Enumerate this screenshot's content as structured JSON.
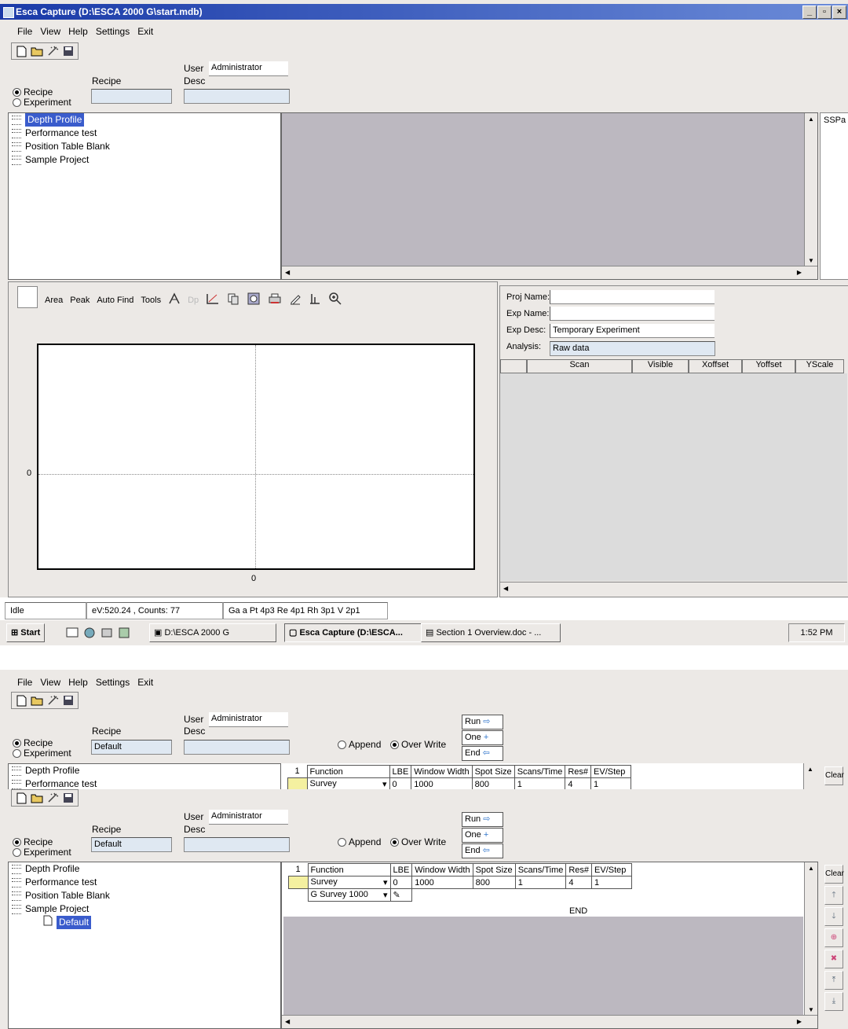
{
  "top": {
    "title": "Esca Capture (D:\\ESCA 2000 G\\start.mdb)",
    "menu": [
      "File",
      "View",
      "Help",
      "Settings",
      "Exit"
    ],
    "user_label": "User",
    "user_value": "Administrator",
    "desc_label": "Desc",
    "recipe_label": "Recipe",
    "radio_recipe": "Recipe",
    "radio_experiment": "Experiment",
    "tree": [
      {
        "label": "Depth Profile",
        "selected": true
      },
      {
        "label": "Performance test",
        "selected": false
      },
      {
        "label": "Position Table Blank",
        "selected": false
      },
      {
        "label": "Sample Project",
        "selected": false
      }
    ],
    "side_label": "SSPa",
    "plot_toolbar": [
      "Area",
      "Peak",
      "Auto Find",
      "Tools"
    ],
    "plot_y_zero": "0",
    "plot_x_zero": "0",
    "proj_name_label": "Proj Name:",
    "exp_name_label": "Exp Name:",
    "exp_desc_label": "Exp Desc:",
    "exp_desc_value": "Temporary Experiment",
    "analysis_label": "Analysis:",
    "analysis_value": "Raw data",
    "scan_columns": [
      "Scan",
      "Visible",
      "Xoffset",
      "Yoffset",
      "YScale"
    ],
    "status": {
      "state": "Idle",
      "readout": "eV:520.24 , Counts: 77",
      "elements": "Ga a  Pt 4p3  Re 4p1  Rh 3p1  V 2p1"
    },
    "taskbar": {
      "start": "Start",
      "items": [
        "D:\\ESCA 2000 G",
        "Esca Capture (D:\\ESCA...",
        "Section 1 Overview.doc - ..."
      ],
      "clock": "1:52 PM"
    }
  },
  "middle": {
    "menu": [
      "File",
      "View",
      "Help",
      "Settings",
      "Exit"
    ],
    "user_label": "User",
    "user_value": "Administrator",
    "desc_label": "Desc",
    "recipe_label": "Recipe",
    "recipe_value": "Default",
    "radio_recipe": "Recipe",
    "radio_experiment": "Experiment",
    "append": "Append",
    "overwrite": "Over Write",
    "run": "Run",
    "one": "One",
    "end": "End",
    "tree": [
      "Depth Profile",
      "Performance test"
    ],
    "grid_headers": [
      "1",
      "Function",
      "LBE",
      "Window Width",
      "Spot Size",
      "Scans/Time",
      "Res#",
      "EV/Step"
    ],
    "grid_row": [
      "",
      "Survey",
      "0",
      "1000",
      "800",
      "1",
      "4",
      "1"
    ],
    "clear": "Clear"
  },
  "bottom": {
    "user_label": "User",
    "user_value": "Administrator",
    "desc_label": "Desc",
    "recipe_label": "Recipe",
    "recipe_value": "Default",
    "radio_recipe": "Recipe",
    "radio_experiment": "Experiment",
    "append": "Append",
    "overwrite": "Over Write",
    "run": "Run",
    "one": "One",
    "end": "End",
    "tree": [
      "Depth Profile",
      "Performance test",
      "Position Table Blank",
      "Sample Project"
    ],
    "tree_child": "Default",
    "grid_headers": [
      "1",
      "Function",
      "LBE",
      "Window Width",
      "Spot Size",
      "Scans/Time",
      "Res#",
      "EV/Step"
    ],
    "grid_row": [
      "",
      "Survey",
      "0",
      "1000",
      "800",
      "1",
      "4",
      "1"
    ],
    "grid_row2": [
      "",
      "G Survey 1000",
      "",
      "",
      "",
      "",
      "",
      ""
    ],
    "end_label": "END",
    "clear": "Clear"
  }
}
